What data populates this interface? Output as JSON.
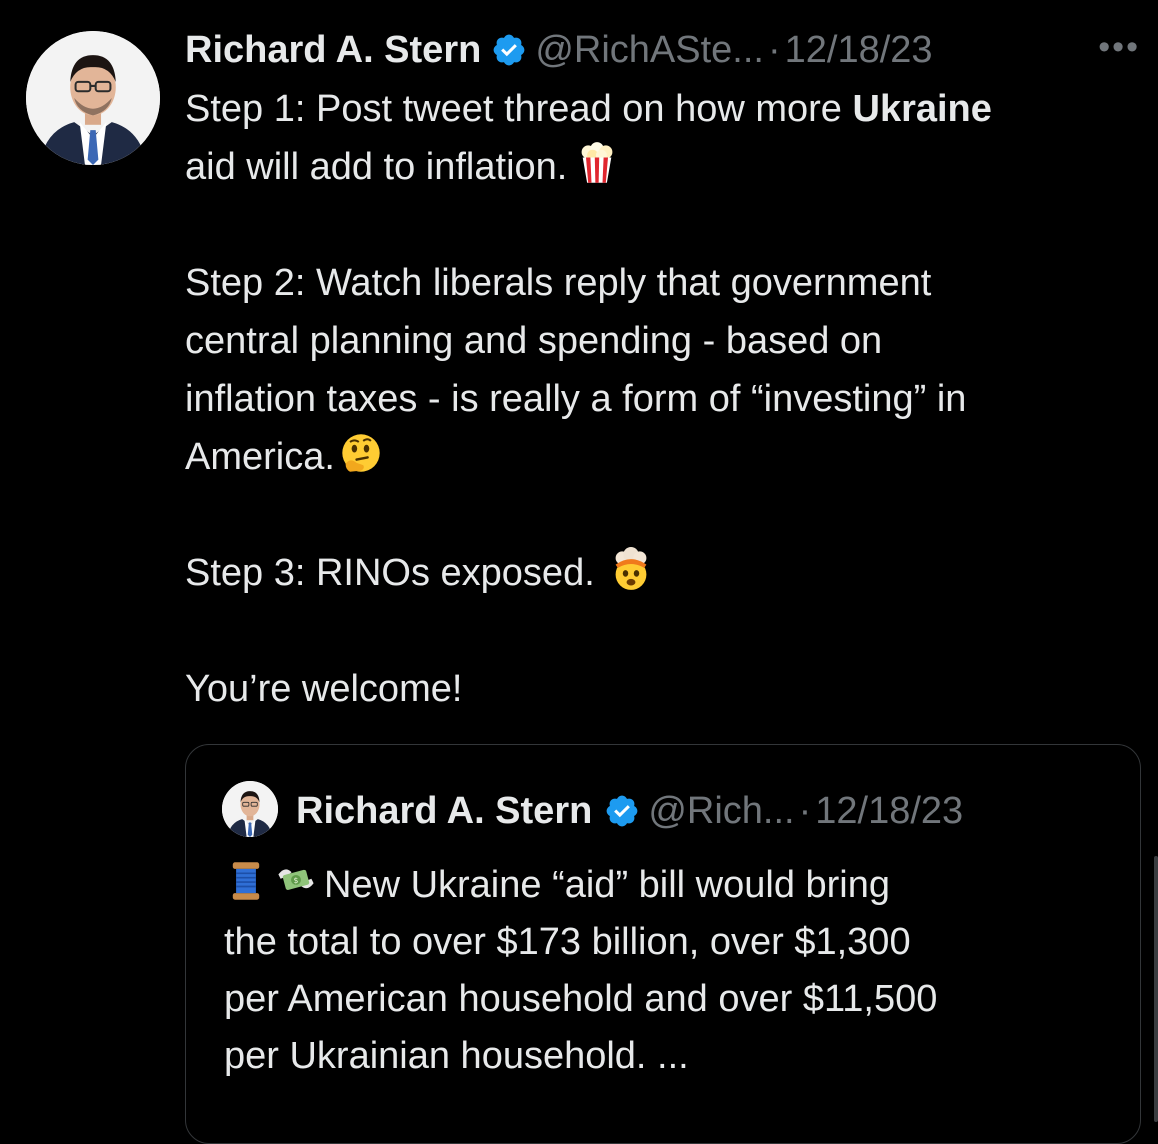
{
  "tweet": {
    "author_name": "Richard A. Stern",
    "handle": "@RichASte...",
    "separator": "·",
    "date": "12/18/23",
    "more_label": "•••",
    "lines": [
      {
        "text": "Step 1: Post tweet thread on how more ",
        "bold": "Ukraine"
      },
      {
        "text": "aid will add to inflation.",
        "emoji": "popcorn-emoji"
      },
      {
        "text": "Step 2: Watch liberals reply that government"
      },
      {
        "text": "central planning and spending - based on"
      },
      {
        "text": "inflation taxes - is really a form of “investing” in"
      },
      {
        "text": "America.",
        "emoji": "thinking-face-emoji"
      },
      {
        "text": "Step 3: RINOs exposed.",
        "emoji": "exploding-head-emoji"
      },
      {
        "text": "You’re welcome!"
      }
    ]
  },
  "quoted": {
    "author_name": "Richard A. Stern",
    "handle": "@Rich...",
    "separator": "·",
    "date": "12/18/23",
    "lines": [
      {
        "text": "New Ukraine “aid” bill would bring",
        "emojis": [
          "thread-spool-emoji",
          "money-with-wings-emoji"
        ]
      },
      {
        "text": "the total to over $173 billion, over $1,300"
      },
      {
        "text": "per American household and over $11,500"
      },
      {
        "text": "per Ukrainian household.  ..."
      }
    ]
  },
  "colors": {
    "background": "#000000",
    "text": "#e7e9ea",
    "muted": "#71767b",
    "verified": "#1d9bf0",
    "border": "#333639"
  }
}
